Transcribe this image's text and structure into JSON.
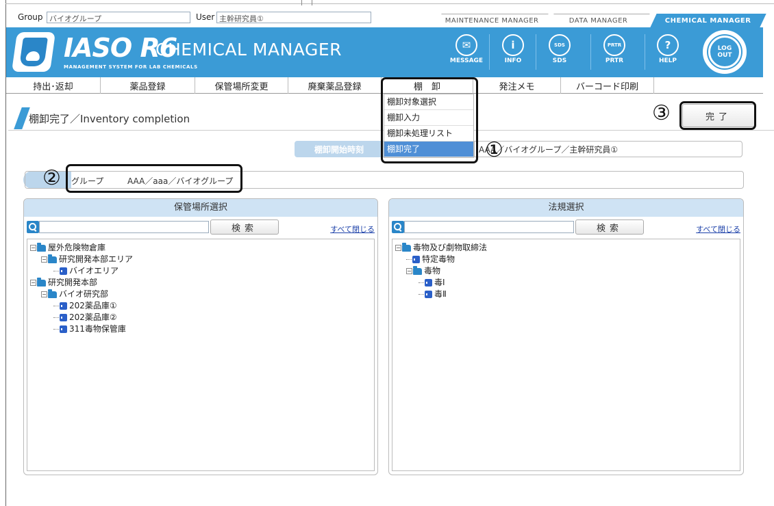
{
  "topbar": {
    "group_label": "Group",
    "group_value": "バイオグループ",
    "user_label": "User",
    "user_value": "主幹研究員①",
    "manager_tabs": [
      {
        "label": "MAINTENANCE MANAGER",
        "active": false
      },
      {
        "label": "DATA MANAGER",
        "active": false
      },
      {
        "label": "CHEMICAL MANAGER",
        "active": true
      }
    ]
  },
  "header": {
    "logo_text": "IASO R6",
    "app_name": "CHEMICAL MANAGER",
    "subtitle": "MANAGEMENT SYSTEM FOR LAB CHEMICALS",
    "brand_color": "#3b9bd6",
    "icons": [
      {
        "glyph": "✉",
        "label": "MESSAGE"
      },
      {
        "glyph": "i",
        "label": "INFO"
      },
      {
        "glyph": "SDS",
        "label": "SDS"
      },
      {
        "glyph": "PRTR",
        "label": "PRTR"
      },
      {
        "glyph": "?",
        "label": "HELP"
      }
    ],
    "logout_label_1": "LOG",
    "logout_label_2": "OUT"
  },
  "nav": {
    "items": [
      "持出･返却",
      "薬品登録",
      "保管場所変更",
      "廃棄薬品登録",
      "棚　卸",
      "発注メモ",
      "バーコード印刷"
    ]
  },
  "dropdown": {
    "items": [
      "棚卸対象選択",
      "棚卸入力",
      "棚卸未処理リスト",
      "棚卸完了"
    ],
    "active_index": 3
  },
  "page": {
    "title": "棚卸完了／Inventory completion",
    "complete_button": "完了"
  },
  "info": {
    "start_label": "棚卸開始時刻",
    "start_value": "AAA／バイオグループ／主幹研究員①",
    "group_label": "グループ",
    "group_value": "AAA／aaa／バイオグループ"
  },
  "annotations": {
    "mark1": "①",
    "mark2": "②",
    "mark3": "③"
  },
  "left_panel": {
    "title": "保管場所選択",
    "search_button": "検索",
    "collapse_all": "すべて閉じる",
    "tree": [
      {
        "level": 0,
        "type": "folder",
        "toggle": "−",
        "label": "屋外危険物倉庫"
      },
      {
        "level": 1,
        "type": "folder",
        "toggle": "−",
        "label": "研究開発本部エリア"
      },
      {
        "level": 2,
        "type": "leaf",
        "label": "バイオエリア"
      },
      {
        "level": 0,
        "type": "folder",
        "toggle": "−",
        "label": "研究開発本部"
      },
      {
        "level": 1,
        "type": "folder",
        "toggle": "−",
        "label": "バイオ研究部"
      },
      {
        "level": 2,
        "type": "leaf",
        "label": "202薬品庫①"
      },
      {
        "level": 2,
        "type": "leaf",
        "label": "202薬品庫②"
      },
      {
        "level": 2,
        "type": "leaf",
        "label": "311毒物保管庫"
      }
    ]
  },
  "right_panel": {
    "title": "法規選択",
    "search_button": "検索",
    "collapse_all": "すべて閉じる",
    "tree": [
      {
        "level": 0,
        "type": "folder",
        "toggle": "−",
        "label": "毒物及び劇物取締法"
      },
      {
        "level": 1,
        "type": "leaf",
        "label": "特定毒物"
      },
      {
        "level": 1,
        "type": "folder",
        "toggle": "−",
        "label": "毒物"
      },
      {
        "level": 2,
        "type": "leaf",
        "label": "毒Ⅰ"
      },
      {
        "level": 2,
        "type": "leaf",
        "label": "毒Ⅱ"
      }
    ]
  }
}
